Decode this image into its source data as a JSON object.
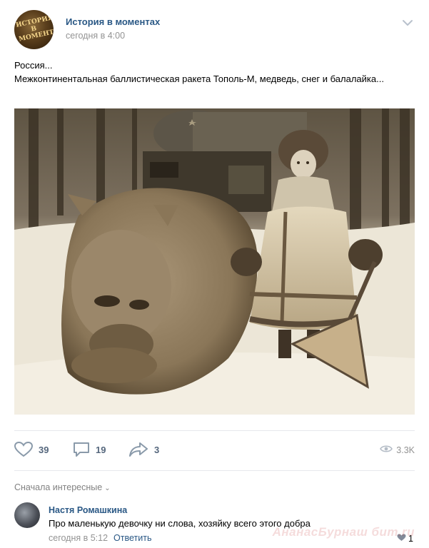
{
  "post": {
    "author": "История в моментах",
    "time": "сегодня в 4:00",
    "avatar_text": "ИСТОРИЯ В МОМЕНТАХ",
    "text_lines": [
      "Россия...",
      "Межконтинентальная баллистическая ракета Тополь-М, медведь, снег и балалайка..."
    ],
    "photo_icon": "bear-girl-balalaika-photo"
  },
  "actions": {
    "likes": "39",
    "comments": "19",
    "shares": "3",
    "views": "3.3K"
  },
  "comments_section": {
    "sort_label": "Сначала интересные",
    "items": [
      {
        "author": "Настя Ромашкина",
        "text": "Про маленькую девочку ни слова, хозяйку всего этого добра",
        "time": "сегодня в 5:12",
        "reply_label": "Ответить",
        "likes": "1"
      }
    ]
  },
  "watermark": "АнанасБурнаш бит.ru",
  "colors": {
    "link": "#2a5885",
    "secondary": "#939393",
    "action": "#55677d",
    "divider": "#e7e8ec"
  }
}
